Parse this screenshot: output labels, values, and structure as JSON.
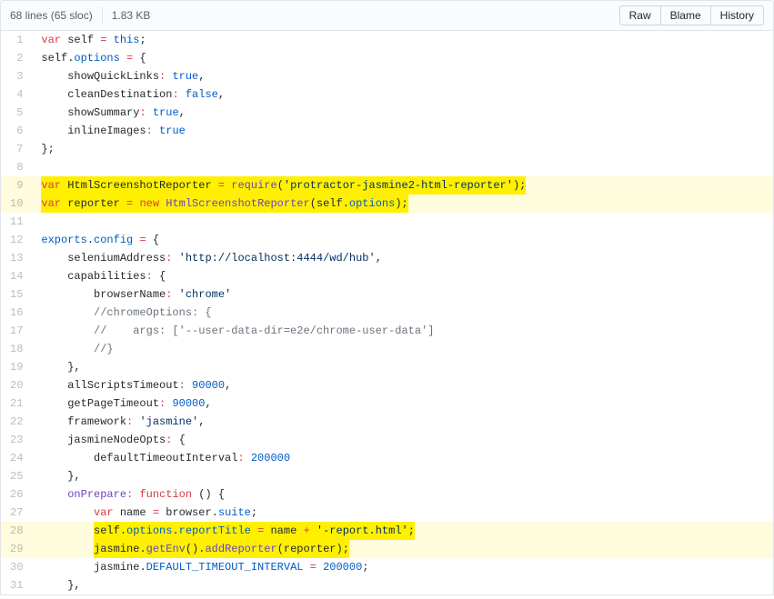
{
  "header": {
    "lines": "68 lines (65 sloc)",
    "size": "1.83 KB",
    "buttons": {
      "raw": "Raw",
      "blame": "Blame",
      "history": "History"
    }
  },
  "code": {
    "lines": [
      {
        "n": 1,
        "hl": false,
        "tokens": [
          [
            "pl-k",
            "var"
          ],
          [
            "sp",
            " "
          ],
          [
            "pl-smi",
            "self"
          ],
          [
            "sp",
            " "
          ],
          [
            "pl-k",
            "="
          ],
          [
            "sp",
            " "
          ],
          [
            "pl-c1",
            "this"
          ],
          [
            "sp",
            ";"
          ]
        ]
      },
      {
        "n": 2,
        "hl": false,
        "tokens": [
          [
            "pl-smi",
            "self"
          ],
          [
            "sp",
            "."
          ],
          [
            "pl-e",
            "options"
          ],
          [
            "sp",
            " "
          ],
          [
            "pl-k",
            "="
          ],
          [
            "sp",
            " {"
          ]
        ]
      },
      {
        "n": 3,
        "hl": false,
        "tokens": [
          [
            "sp",
            "    "
          ],
          [
            "pl-smi",
            "showQuickLinks"
          ],
          [
            "pl-k",
            ":"
          ],
          [
            "sp",
            " "
          ],
          [
            "pl-c1",
            "true"
          ],
          [
            "sp",
            ","
          ]
        ]
      },
      {
        "n": 4,
        "hl": false,
        "tokens": [
          [
            "sp",
            "    "
          ],
          [
            "pl-smi",
            "cleanDestination"
          ],
          [
            "pl-k",
            ":"
          ],
          [
            "sp",
            " "
          ],
          [
            "pl-c1",
            "false"
          ],
          [
            "sp",
            ","
          ]
        ]
      },
      {
        "n": 5,
        "hl": false,
        "tokens": [
          [
            "sp",
            "    "
          ],
          [
            "pl-smi",
            "showSummary"
          ],
          [
            "pl-k",
            ":"
          ],
          [
            "sp",
            " "
          ],
          [
            "pl-c1",
            "true"
          ],
          [
            "sp",
            ","
          ]
        ]
      },
      {
        "n": 6,
        "hl": false,
        "tokens": [
          [
            "sp",
            "    "
          ],
          [
            "pl-smi",
            "inlineImages"
          ],
          [
            "pl-k",
            ":"
          ],
          [
            "sp",
            " "
          ],
          [
            "pl-c1",
            "true"
          ]
        ]
      },
      {
        "n": 7,
        "hl": false,
        "tokens": [
          [
            "sp",
            "};"
          ]
        ]
      },
      {
        "n": 8,
        "hl": false,
        "tokens": [
          [
            "sp",
            ""
          ]
        ]
      },
      {
        "n": 9,
        "hl": true,
        "mark": true,
        "tokens": [
          [
            "pl-k",
            "var"
          ],
          [
            "sp",
            " "
          ],
          [
            "pl-smi",
            "HtmlScreenshotReporter"
          ],
          [
            "sp",
            " "
          ],
          [
            "pl-k",
            "="
          ],
          [
            "sp",
            " "
          ],
          [
            "pl-en",
            "require"
          ],
          [
            "sp",
            "("
          ],
          [
            "pl-s",
            "'protractor-jasmine2-html-reporter'"
          ],
          [
            "sp",
            ");"
          ]
        ]
      },
      {
        "n": 10,
        "hl": true,
        "mark": true,
        "tokens": [
          [
            "pl-k",
            "var"
          ],
          [
            "sp",
            " "
          ],
          [
            "pl-smi",
            "reporter"
          ],
          [
            "sp",
            " "
          ],
          [
            "pl-k",
            "="
          ],
          [
            "sp",
            " "
          ],
          [
            "pl-k",
            "new"
          ],
          [
            "sp",
            " "
          ],
          [
            "pl-en",
            "HtmlScreenshotReporter"
          ],
          [
            "sp",
            "("
          ],
          [
            "pl-smi",
            "self"
          ],
          [
            "sp",
            "."
          ],
          [
            "pl-e",
            "options"
          ],
          [
            "sp",
            ");"
          ]
        ]
      },
      {
        "n": 11,
        "hl": false,
        "tokens": [
          [
            "sp",
            ""
          ]
        ]
      },
      {
        "n": 12,
        "hl": false,
        "tokens": [
          [
            "pl-c1",
            "exports"
          ],
          [
            "sp",
            "."
          ],
          [
            "pl-e",
            "config"
          ],
          [
            "sp",
            " "
          ],
          [
            "pl-k",
            "="
          ],
          [
            "sp",
            " {"
          ]
        ]
      },
      {
        "n": 13,
        "hl": false,
        "tokens": [
          [
            "sp",
            "    "
          ],
          [
            "pl-smi",
            "seleniumAddress"
          ],
          [
            "pl-k",
            ":"
          ],
          [
            "sp",
            " "
          ],
          [
            "pl-s",
            "'http://localhost:4444/wd/hub'"
          ],
          [
            "sp",
            ","
          ]
        ]
      },
      {
        "n": 14,
        "hl": false,
        "tokens": [
          [
            "sp",
            "    "
          ],
          [
            "pl-smi",
            "capabilities"
          ],
          [
            "pl-k",
            ":"
          ],
          [
            "sp",
            " {"
          ]
        ]
      },
      {
        "n": 15,
        "hl": false,
        "tokens": [
          [
            "sp",
            "        "
          ],
          [
            "pl-smi",
            "browserName"
          ],
          [
            "pl-k",
            ":"
          ],
          [
            "sp",
            " "
          ],
          [
            "pl-s",
            "'chrome'"
          ]
        ]
      },
      {
        "n": 16,
        "hl": false,
        "tokens": [
          [
            "sp",
            "        "
          ],
          [
            "pl-c",
            "//chromeOptions: {"
          ]
        ]
      },
      {
        "n": 17,
        "hl": false,
        "tokens": [
          [
            "sp",
            "        "
          ],
          [
            "pl-c",
            "//    args: ['--user-data-dir=e2e/chrome-user-data']"
          ]
        ]
      },
      {
        "n": 18,
        "hl": false,
        "tokens": [
          [
            "sp",
            "        "
          ],
          [
            "pl-c",
            "//}"
          ]
        ]
      },
      {
        "n": 19,
        "hl": false,
        "tokens": [
          [
            "sp",
            "    },"
          ]
        ]
      },
      {
        "n": 20,
        "hl": false,
        "tokens": [
          [
            "sp",
            "    "
          ],
          [
            "pl-smi",
            "allScriptsTimeout"
          ],
          [
            "pl-k",
            ":"
          ],
          [
            "sp",
            " "
          ],
          [
            "pl-c1",
            "90000"
          ],
          [
            "sp",
            ","
          ]
        ]
      },
      {
        "n": 21,
        "hl": false,
        "tokens": [
          [
            "sp",
            "    "
          ],
          [
            "pl-smi",
            "getPageTimeout"
          ],
          [
            "pl-k",
            ":"
          ],
          [
            "sp",
            " "
          ],
          [
            "pl-c1",
            "90000"
          ],
          [
            "sp",
            ","
          ]
        ]
      },
      {
        "n": 22,
        "hl": false,
        "tokens": [
          [
            "sp",
            "    "
          ],
          [
            "pl-smi",
            "framework"
          ],
          [
            "pl-k",
            ":"
          ],
          [
            "sp",
            " "
          ],
          [
            "pl-s",
            "'jasmine'"
          ],
          [
            "sp",
            ","
          ]
        ]
      },
      {
        "n": 23,
        "hl": false,
        "tokens": [
          [
            "sp",
            "    "
          ],
          [
            "pl-smi",
            "jasmineNodeOpts"
          ],
          [
            "pl-k",
            ":"
          ],
          [
            "sp",
            " {"
          ]
        ]
      },
      {
        "n": 24,
        "hl": false,
        "tokens": [
          [
            "sp",
            "        "
          ],
          [
            "pl-smi",
            "defaultTimeoutInterval"
          ],
          [
            "pl-k",
            ":"
          ],
          [
            "sp",
            " "
          ],
          [
            "pl-c1",
            "200000"
          ]
        ]
      },
      {
        "n": 25,
        "hl": false,
        "tokens": [
          [
            "sp",
            "    },"
          ]
        ]
      },
      {
        "n": 26,
        "hl": false,
        "tokens": [
          [
            "sp",
            "    "
          ],
          [
            "pl-en",
            "onPrepare"
          ],
          [
            "pl-k",
            ":"
          ],
          [
            "sp",
            " "
          ],
          [
            "pl-k",
            "function"
          ],
          [
            "sp",
            " () {"
          ]
        ]
      },
      {
        "n": 27,
        "hl": false,
        "tokens": [
          [
            "sp",
            "        "
          ],
          [
            "pl-k",
            "var"
          ],
          [
            "sp",
            " "
          ],
          [
            "pl-smi",
            "name"
          ],
          [
            "sp",
            " "
          ],
          [
            "pl-k",
            "="
          ],
          [
            "sp",
            " "
          ],
          [
            "pl-smi",
            "browser"
          ],
          [
            "sp",
            "."
          ],
          [
            "pl-e",
            "suite"
          ],
          [
            "sp",
            ";"
          ]
        ]
      },
      {
        "n": 28,
        "hl": true,
        "mark": true,
        "indent": "        ",
        "tokens": [
          [
            "pl-smi",
            "self"
          ],
          [
            "sp",
            "."
          ],
          [
            "pl-e",
            "options"
          ],
          [
            "sp",
            "."
          ],
          [
            "pl-e",
            "reportTitle"
          ],
          [
            "sp",
            " "
          ],
          [
            "pl-k",
            "="
          ],
          [
            "sp",
            " "
          ],
          [
            "pl-smi",
            "name"
          ],
          [
            "sp",
            " "
          ],
          [
            "pl-k",
            "+"
          ],
          [
            "sp",
            " "
          ],
          [
            "pl-s",
            "'-report.html'"
          ],
          [
            "sp",
            ";"
          ]
        ]
      },
      {
        "n": 29,
        "hl": true,
        "mark": true,
        "indent": "        ",
        "tokens": [
          [
            "pl-smi",
            "jasmine"
          ],
          [
            "sp",
            "."
          ],
          [
            "pl-en",
            "getEnv"
          ],
          [
            "sp",
            "()."
          ],
          [
            "pl-en",
            "addReporter"
          ],
          [
            "sp",
            "("
          ],
          [
            "pl-smi",
            "reporter"
          ],
          [
            "sp",
            ");"
          ]
        ]
      },
      {
        "n": 30,
        "hl": false,
        "tokens": [
          [
            "sp",
            "        "
          ],
          [
            "pl-smi",
            "jasmine"
          ],
          [
            "sp",
            "."
          ],
          [
            "pl-c1",
            "DEFAULT_TIMEOUT_INTERVAL"
          ],
          [
            "sp",
            " "
          ],
          [
            "pl-k",
            "="
          ],
          [
            "sp",
            " "
          ],
          [
            "pl-c1",
            "200000"
          ],
          [
            "sp",
            ";"
          ]
        ]
      },
      {
        "n": 31,
        "hl": false,
        "tokens": [
          [
            "sp",
            "    },"
          ]
        ]
      }
    ]
  }
}
